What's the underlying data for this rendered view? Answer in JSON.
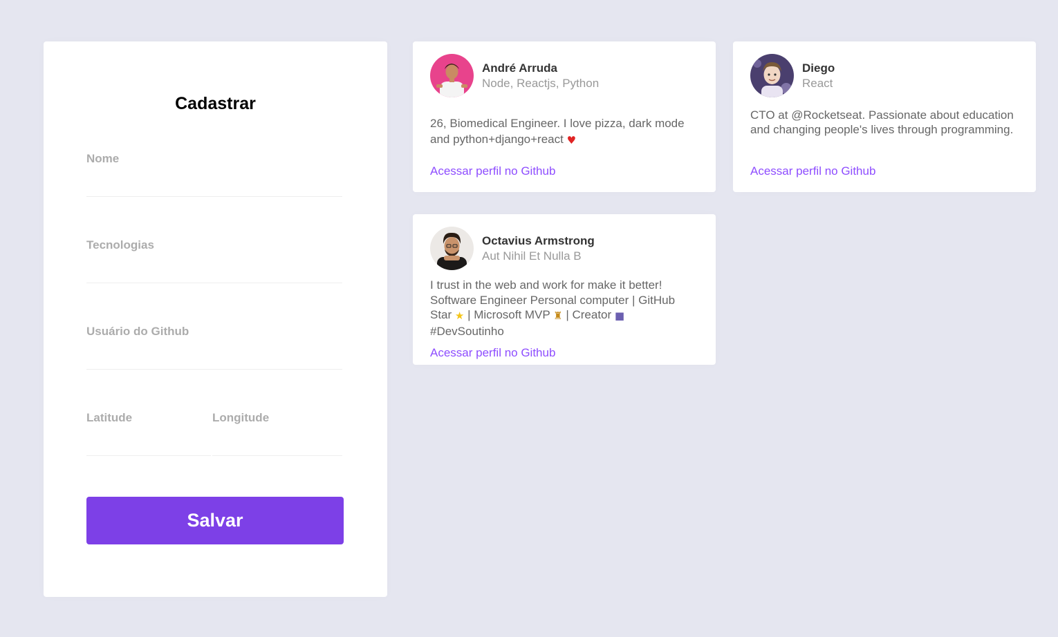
{
  "form": {
    "title": "Cadastrar",
    "fields": {
      "name": {
        "label": "Nome",
        "value": ""
      },
      "techs": {
        "label": "Tecnologias",
        "value": ""
      },
      "github_username": {
        "label": "Usuário do Github",
        "value": ""
      },
      "latitude": {
        "label": "Latitude",
        "value": ""
      },
      "longitude": {
        "label": "Longitude",
        "value": ""
      }
    },
    "submit_label": "Salvar"
  },
  "devs": [
    {
      "name": "André Arruda",
      "techs": "Node, Reactjs, Python",
      "bio_parts": [
        "26, Biomedical Engineer. I love pizza, dark mode and python+django+react "
      ],
      "emoji": {
        "heart": "♥"
      },
      "link_label": "Acessar perfil no Github",
      "avatar_icon": "avatar-photo-icon",
      "avatar_bg": "#e8438c"
    },
    {
      "name": "Diego",
      "techs": "React",
      "bio_parts": [
        "CTO at @Rocketseat. Passionate about education and changing people's lives through programming."
      ],
      "link_label": "Acessar perfil no Github",
      "avatar_icon": "avatar-photo-icon",
      "avatar_bg": "#4a3f6e"
    },
    {
      "name": "Octavius Armstrong",
      "techs": "Aut Nihil Et Nulla B",
      "bio_parts": [
        "I trust in the web and work for make it better! Software Engineer Personal computer | GitHub Star ",
        " | Microsoft MVP ",
        " | Creator ",
        " #DevSoutinho"
      ],
      "emoji": {
        "star": "★",
        "trophy": "♜",
        "camera": "■"
      },
      "link_label": "Acessar perfil no Github",
      "avatar_icon": "avatar-photo-icon",
      "avatar_bg": "#2d2620"
    }
  ],
  "colors": {
    "background": "#e5e6f0",
    "accent": "#7d40e7",
    "link": "#8e4dff",
    "label": "#acacac"
  }
}
